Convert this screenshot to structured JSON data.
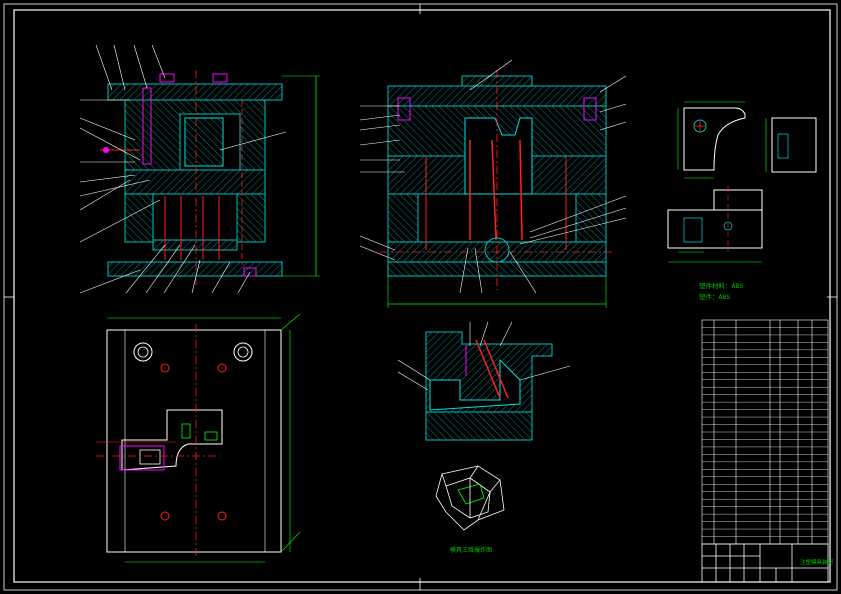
{
  "drawing": {
    "notes": {
      "line1": "塑件材料：ABS",
      "line2": "塑件：ABS",
      "caption": "模具三维爆炸图"
    },
    "title_block": {
      "title_text": "注塑模具装配"
    }
  },
  "colors": {
    "background": "#000000",
    "frame": "#ffffff",
    "plate": "#00c0c0",
    "hatch": "#008888",
    "dimension": "#00ff00",
    "leader": "#ffffff",
    "centerline": "#ff2020",
    "accent": "#ff00ff",
    "text": "#ffff00"
  }
}
